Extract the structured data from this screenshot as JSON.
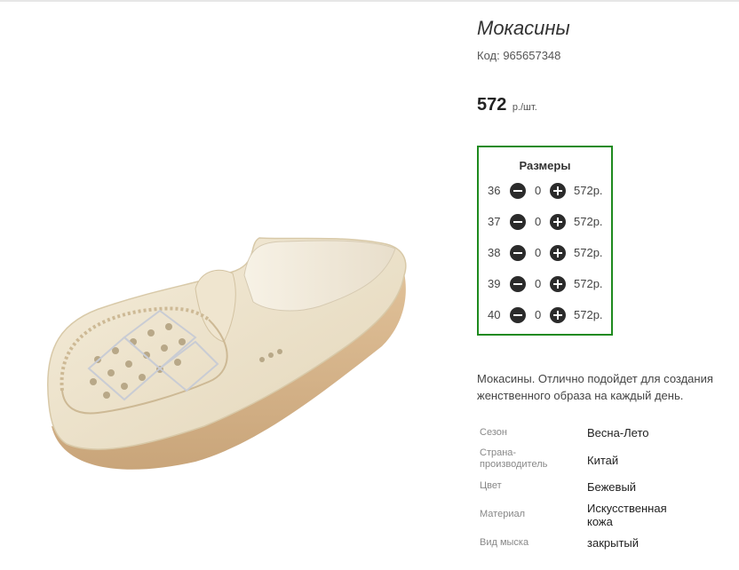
{
  "product": {
    "title": "Мокасины",
    "code": "Код: 965657348",
    "price": "572",
    "price_unit": "р./шт."
  },
  "sizes": {
    "title": "Размеры",
    "rows": [
      {
        "size": "36",
        "qty": "0",
        "price": "572р."
      },
      {
        "size": "37",
        "qty": "0",
        "price": "572р."
      },
      {
        "size": "38",
        "qty": "0",
        "price": "572р."
      },
      {
        "size": "39",
        "qty": "0",
        "price": "572р."
      },
      {
        "size": "40",
        "qty": "0",
        "price": "572р."
      }
    ]
  },
  "description": "Мокасины. Отлично подойдет для создания женственного образа на каждый день.",
  "attributes": [
    {
      "key": "Сезон",
      "value": "Весна-Лето"
    },
    {
      "key": "Страна-производитель",
      "value": "Китай"
    },
    {
      "key": "Цвет",
      "value": "Бежевый"
    },
    {
      "key": "Материал",
      "value": "Искусственная кожа"
    },
    {
      "key": "Вид мыска",
      "value": "закрытый"
    }
  ],
  "colors": {
    "sizes_border": "#1e8a1e",
    "shoe_upper": "#ede3cc",
    "shoe_sole": "#d9b98f",
    "button": "#2b2b2b"
  }
}
